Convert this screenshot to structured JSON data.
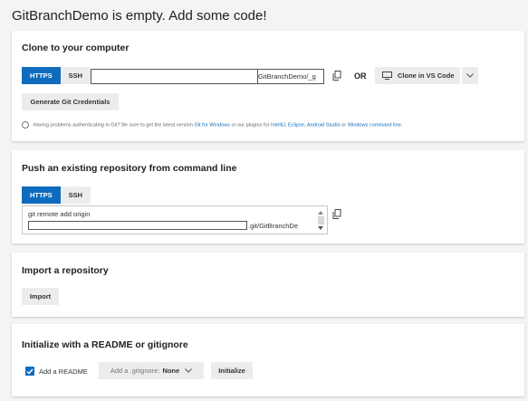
{
  "page": {
    "title": "GitBranchDemo is empty. Add some code!"
  },
  "clone": {
    "title": "Clone to your computer",
    "protocols": [
      "HTTPS",
      "SSH"
    ],
    "url_suffix": "GitBranchDemo/_g",
    "or_label": "OR",
    "clone_vs_code_label": "Clone in VS Code",
    "gen_credentials_label": "Generate Git Credentials",
    "help": {
      "prefix": "Having problems authenticating in Git? Be sure to get the latest version",
      "git_for_windows": "Git for Windows",
      "mid": "or our plugins for",
      "intellij": "IntelliJ",
      "eclipse": "Eclipse",
      "android_studio": "Android Studio",
      "or": "or",
      "windows_cmd": "Windows command line",
      "comma": ",",
      "period": "."
    }
  },
  "push": {
    "title": "Push an existing repository from command line",
    "protocols": [
      "HTTPS",
      "SSH"
    ],
    "line1": "git remote add origin",
    "line2_suffix": ".git/GitBranchDe"
  },
  "import": {
    "title": "Import a repository",
    "button_label": "Import"
  },
  "init": {
    "title": "Initialize with a README or gitignore",
    "add_readme_label": "Add a README",
    "gitignore_prefix": "Add a .gitignore:",
    "gitignore_value": "None",
    "initialize_label": "Initialize"
  },
  "colors": {
    "accent": "#0f6cbd",
    "background": "#f4f4f4",
    "card": "#ffffff"
  },
  "icons": [
    "copy-icon",
    "vscode-icon",
    "chevron-down-icon",
    "checkmark-icon",
    "info-icon",
    "scroll-up-icon",
    "scroll-down-icon"
  ]
}
